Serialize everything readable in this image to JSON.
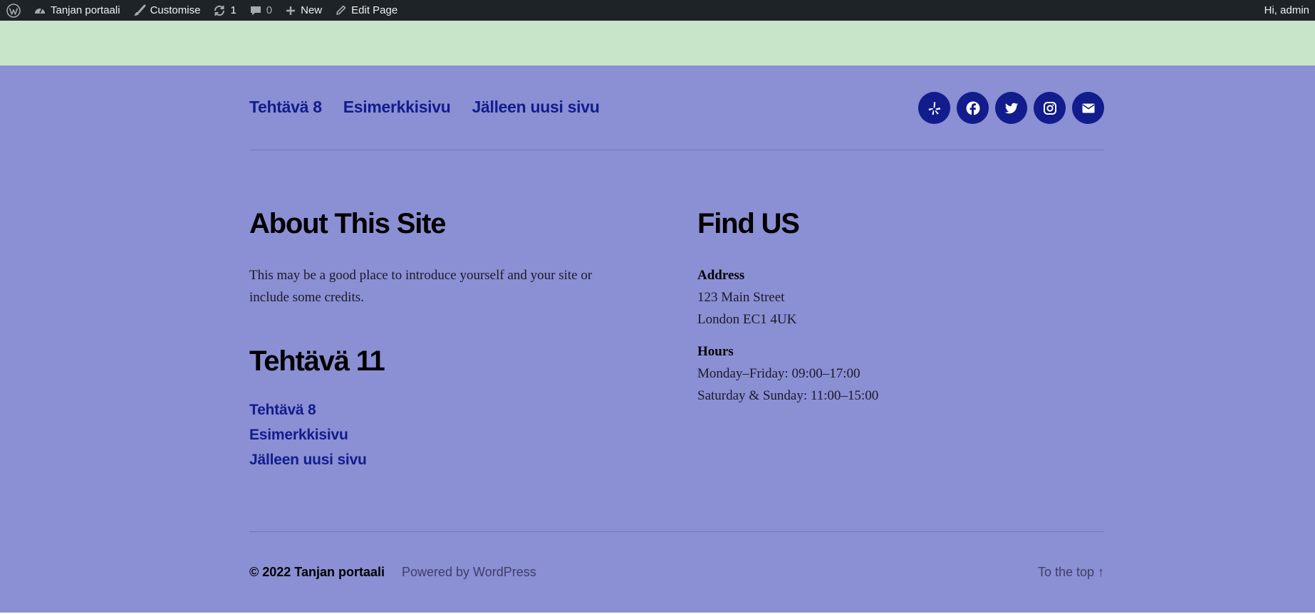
{
  "adminbar": {
    "site_name": "Tanjan portaali",
    "customise": "Customise",
    "updates_count": "1",
    "comments_count": "0",
    "new_label": "New",
    "edit_label": "Edit Page",
    "greeting": "Hi, admin"
  },
  "footer": {
    "menu": [
      "Tehtävä 8",
      "Esimerkkisivu",
      "Jälleen uusi sivu"
    ],
    "socials": [
      "yelp-icon",
      "facebook-icon",
      "twitter-icon",
      "instagram-icon",
      "mail-icon"
    ],
    "about": {
      "title": "About This Site",
      "text": "This may be a good place to introduce yourself and your site or include some credits."
    },
    "find_us": {
      "title": "Find US",
      "address_label": "Address",
      "address_line1": "123 Main Street",
      "address_line2": "London EC1 4UK",
      "hours_label": "Hours",
      "hours_line1": "Monday–Friday: 09:00–17:00",
      "hours_line2": "Saturday & Sunday: 11:00–15:00"
    },
    "tehtava": {
      "title": "Tehtävä 11",
      "links": [
        "Tehtävä 8",
        "Esimerkkisivu",
        "Jälleen uusi sivu"
      ]
    },
    "copyright": "© 2022 Tanjan portaali",
    "powered_by": "Powered by WordPress",
    "to_top": "To the top ↑"
  },
  "colors": {
    "adminbar_bg": "#1d2327",
    "band_green": "#c8e4c9",
    "footer_bg": "#8b8fd3",
    "accent": "#121c8c"
  }
}
